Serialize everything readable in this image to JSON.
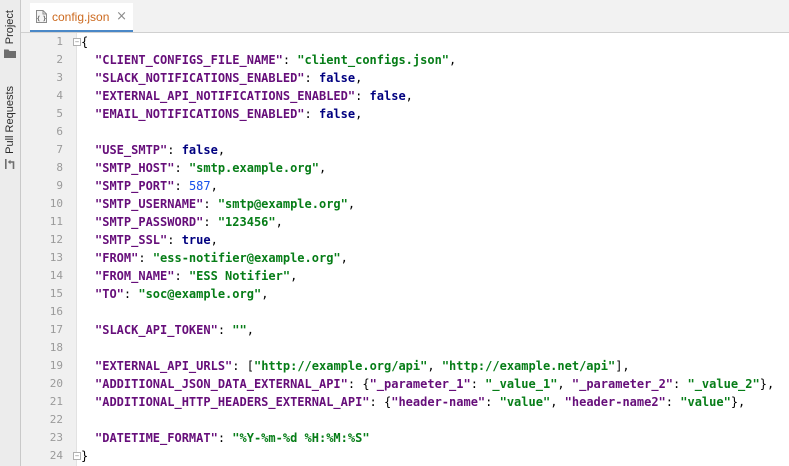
{
  "sidebar": {
    "project_label": "Project",
    "pull_requests_label": "Pull Requests",
    "project_icon": "folder-icon",
    "pull_requests_icon": "pull-request-icon"
  },
  "tab": {
    "title": "config.json",
    "close_glyph": "×",
    "icon": "json-file-icon"
  },
  "editor": {
    "line_numbers": [
      "1",
      "2",
      "3",
      "4",
      "5",
      "6",
      "7",
      "8",
      "9",
      "10",
      "11",
      "12",
      "13",
      "14",
      "15",
      "16",
      "17",
      "18",
      "19",
      "20",
      "21",
      "22",
      "23",
      "24"
    ],
    "open_brace": "{",
    "close_brace": "}",
    "lines": {
      "l2": {
        "key": "\"CLIENT_CONFIGS_FILE_NAME\"",
        "value": "\"client_configs.json\""
      },
      "l3": {
        "key": "\"SLACK_NOTIFICATIONS_ENABLED\"",
        "value": "false"
      },
      "l4": {
        "key": "\"EXTERNAL_API_NOTIFICATIONS_ENABLED\"",
        "value": "false"
      },
      "l5": {
        "key": "\"EMAIL_NOTIFICATIONS_ENABLED\"",
        "value": "false"
      },
      "l7": {
        "key": "\"USE_SMTP\"",
        "value": "false"
      },
      "l8": {
        "key": "\"SMTP_HOST\"",
        "value": "\"smtp.example.org\""
      },
      "l9": {
        "key": "\"SMTP_PORT\"",
        "value": "587"
      },
      "l10": {
        "key": "\"SMTP_USERNAME\"",
        "value": "\"smtp@example.org\""
      },
      "l11": {
        "key": "\"SMTP_PASSWORD\"",
        "value": "\"123456\""
      },
      "l12": {
        "key": "\"SMTP_SSL\"",
        "value": "true"
      },
      "l13": {
        "key": "\"FROM\"",
        "value": "\"ess-notifier@example.org\""
      },
      "l14": {
        "key": "\"FROM_NAME\"",
        "value": "\"ESS Notifier\""
      },
      "l15": {
        "key": "\"TO\"",
        "value": "\"soc@example.org\""
      },
      "l17": {
        "key": "\"SLACK_API_TOKEN\"",
        "value": "\"\""
      },
      "l19": {
        "key": "\"EXTERNAL_API_URLS\"",
        "v1": "\"http://example.org/api\"",
        "v2": "\"http://example.net/api\""
      },
      "l20": {
        "key": "\"ADDITIONAL_JSON_DATA_EXTERNAL_API\"",
        "k1": "\"_parameter_1\"",
        "v1": "\"_value_1\"",
        "k2": "\"_parameter_2\"",
        "v2": "\"_value_2\""
      },
      "l21": {
        "key": "\"ADDITIONAL_HTTP_HEADERS_EXTERNAL_API\"",
        "k1": "\"header-name\"",
        "v1": "\"value\"",
        "k2": "\"header-name2\"",
        "v2": "\"value\""
      },
      "l23": {
        "key": "\"DATETIME_FORMAT\"",
        "value": "\"%Y-%m-%d %H:%M:%S\""
      }
    }
  },
  "colors": {
    "key": "#660e7a",
    "string": "#067d17",
    "keyword": "#000080",
    "number": "#1750eb",
    "tab_title": "#cc6a1f",
    "tab_underline": "#4a88c7"
  }
}
